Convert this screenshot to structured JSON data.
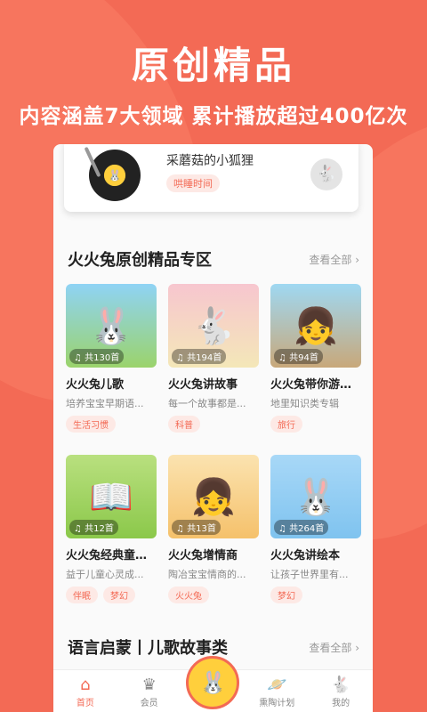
{
  "hero": {
    "title": "原创精品",
    "subtitle": "内容涵盖7大领域  累计播放超过400亿次"
  },
  "player": {
    "track_title": "采蘑菇的小狐狸",
    "tag": "哄睡时间"
  },
  "section1": {
    "title": "火火兔原创精品专区",
    "more": "查看全部  ›",
    "cards": [
      {
        "count": "♫ 共130首",
        "title": "火火兔儿歌",
        "desc": "培养宝宝早期语...",
        "tags": [
          "生活习惯"
        ]
      },
      {
        "count": "♫ 共194首",
        "title": "火火兔讲故事",
        "desc": "每一个故事都是...",
        "tags": [
          "科普"
        ]
      },
      {
        "count": "♫ 共94首",
        "title": "火火兔带你游中...",
        "desc": "地里知识类专辑",
        "tags": [
          "旅行"
        ]
      },
      {
        "count": "♫ 共12首",
        "title": "火火兔经典童话...",
        "desc": "益于儿童心灵成...",
        "tags": [
          "伴眠",
          "梦幻"
        ]
      },
      {
        "count": "♫ 共13首",
        "title": "火火兔增情商",
        "desc": "陶冶宝宝情商的...",
        "tags": [
          "火火兔"
        ]
      },
      {
        "count": "♫ 共264首",
        "title": "火火兔讲绘本",
        "desc": "让孩子世界里有...",
        "tags": [
          "梦幻"
        ]
      }
    ]
  },
  "section2": {
    "title": "语言启蒙丨儿歌故事类",
    "more": "查看全部  ›"
  },
  "tabbar": {
    "home": "首页",
    "member": "会员",
    "plan": "熏陶计划",
    "mine": "我的"
  },
  "colors": {
    "brand": "#f36a55",
    "tag_bg": "#fde9e5"
  }
}
